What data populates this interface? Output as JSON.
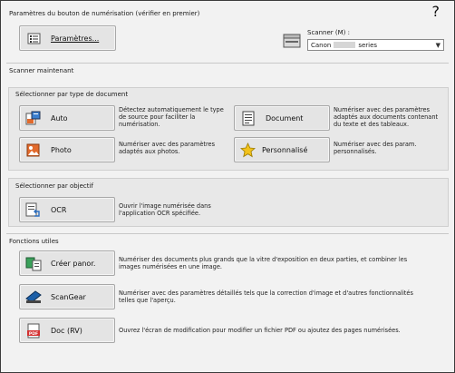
{
  "header": {
    "section_title": "Paramètres du bouton de numérisation (vérifier en premier)",
    "help_glyph": "?",
    "settings_label": "Paramètres...",
    "scanner_label": "Scanner (M) :",
    "scanner_value_prefix": "Canon",
    "scanner_value_suffix": "series"
  },
  "sections": {
    "scan_now": "Scanner maintenant",
    "by_doc_type": "Sélectionner par type de document",
    "by_objective": "Sélectionner par objectif",
    "utilities": "Fonctions utiles"
  },
  "doc_type_buttons": [
    {
      "label": "Auto",
      "desc": "Détectez automatiquement le type de source pour faciliter la numérisation."
    },
    {
      "label": "Document",
      "desc": "Numériser avec des paramètres adaptés aux documents contenant du texte et des tableaux."
    },
    {
      "label": "Photo",
      "desc": "Numériser avec des paramètres adaptés aux photos."
    },
    {
      "label": "Personnalisé",
      "desc": "Numériser avec des param. personnalisés."
    }
  ],
  "objective_buttons": [
    {
      "label": "OCR",
      "desc": "Ouvrir l'image numérisée dans l'application OCR spécifiée."
    }
  ],
  "utility_buttons": [
    {
      "label": "Créer panor.",
      "desc": "Numériser des documents plus grands que la vitre d'exposition en deux parties, et combiner les images numérisées en une image."
    },
    {
      "label": "ScanGear",
      "desc": "Numériser avec des paramètres détaillés tels que la correction d'image et d'autres fonctionnalités telles que l'aperçu."
    },
    {
      "label": "Doc (RV)",
      "desc": "Ouvrez l'écran de modification pour modifier un fichier PDF ou ajoutez des pages numérisées."
    }
  ],
  "icons": {
    "settings": "settings-list-icon",
    "scanner": "scanner-device-icon",
    "auto": "auto-scan-icon",
    "document": "document-icon",
    "photo": "photo-icon",
    "custom": "star-icon",
    "ocr": "ocr-icon",
    "panorama": "stitch-icon",
    "scangear": "scangear-icon",
    "pdf": "pdf-icon"
  }
}
